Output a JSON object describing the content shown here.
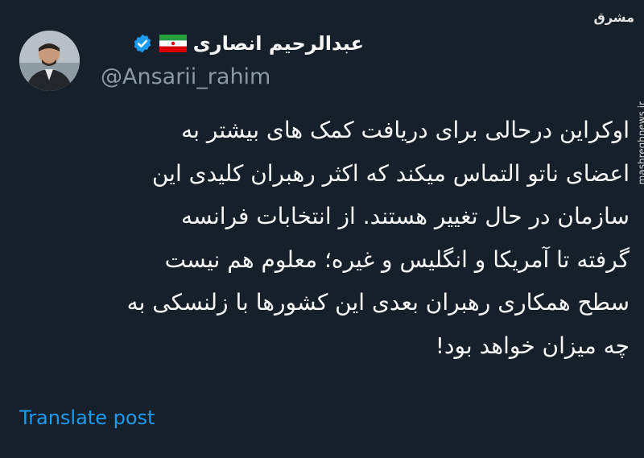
{
  "author": {
    "display_name": "عبدالرحیم انصاری",
    "handle": "@Ansarii_rahim",
    "flag_icon": "iran-flag-icon",
    "verified_icon": "verified-badge-icon",
    "verified_color": "#1d9bf0"
  },
  "post": {
    "text": "اوکراین درحالی برای دریافت کمک های بیشتر به\nاعضای ناتو التماس میکند که اکثر رهبران کلیدی این\nسازمان در حال تغییر هستند. از انتخابات فرانسه\nگرفته تا آمریکا و انگلیس و غیره؛ معلوم هم نیست\nسطح همکاری رهبران بعدی این کشورها با زلنسکی به\nچه میزان خواهد بود!"
  },
  "actions": {
    "translate_label": "Translate post"
  },
  "watermark": {
    "url": "mashreghnews.ir"
  },
  "colors": {
    "background": "#15202b",
    "text": "#f7f9f9",
    "muted": "#8b98a5",
    "link": "#1d9bf0"
  }
}
